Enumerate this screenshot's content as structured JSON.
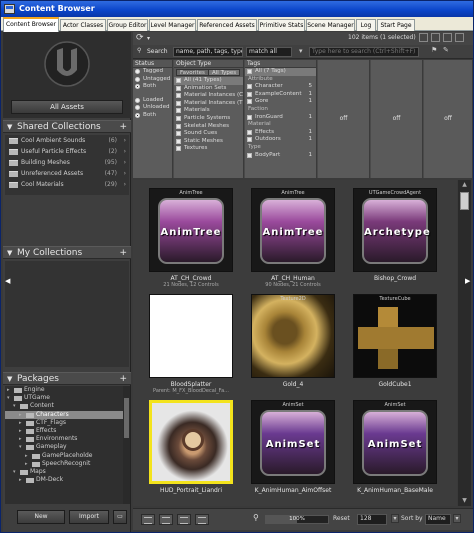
{
  "window": {
    "title": "Content Browser"
  },
  "tabs": [
    {
      "label": "Content Browser"
    },
    {
      "label": "Actor Classes"
    },
    {
      "label": "Group Editor"
    },
    {
      "label": "Level Manager"
    },
    {
      "label": "Referenced Assets"
    },
    {
      "label": "Primitive Stats"
    },
    {
      "label": "Scene Manager"
    },
    {
      "label": "Log"
    },
    {
      "label": "Start Page"
    }
  ],
  "left": {
    "all_assets_label": "All Assets",
    "shared_collections": {
      "title": "Shared Collections",
      "items": [
        {
          "label": "Cool Ambient Sounds",
          "count": "(6)"
        },
        {
          "label": "Useful Particle Effects",
          "count": "(2)"
        },
        {
          "label": "Building Meshes",
          "count": "(95)"
        },
        {
          "label": "Unreferenced Assets",
          "count": "(47)"
        },
        {
          "label": "Cool Materials",
          "count": "(29)"
        }
      ]
    },
    "my_collections": {
      "title": "My Collections"
    },
    "packages": {
      "title": "Packages",
      "tree": [
        {
          "label": "Engine"
        },
        {
          "label": "UTGame"
        },
        {
          "label": "Content"
        },
        {
          "label": "Characters"
        },
        {
          "label": "CTF_Flags"
        },
        {
          "label": "Effects"
        },
        {
          "label": "Environments"
        },
        {
          "label": "Gameplay"
        },
        {
          "label": "GamePlaceholde"
        },
        {
          "label": "SpeechRecognit"
        },
        {
          "label": "Maps"
        },
        {
          "label": "DM-Deck"
        }
      ]
    },
    "new_label": "New",
    "import_label": "Import"
  },
  "toolbar": {
    "items_count": "102 items (1 selected)",
    "search_label": "Search",
    "search_fields": "name, path, tags, type",
    "match_mode": "match all",
    "search_placeholder": "Type here to search (Ctrl+Shift+F)"
  },
  "filters": {
    "status": {
      "title": "Status",
      "rows": [
        {
          "label": "Tagged",
          "on": false
        },
        {
          "label": "Untagged",
          "on": false
        },
        {
          "label": "Both",
          "on": true
        },
        {
          "label": "Loaded",
          "on": false
        },
        {
          "label": "Unloaded",
          "on": false
        },
        {
          "label": "Both",
          "on": true
        }
      ]
    },
    "object_type": {
      "title": "Object Type",
      "tab_favorites": "Favorites",
      "tab_all_types": "All Types",
      "rows": [
        "All (41 Types)",
        "Animation Sets",
        "Material Instances (C",
        "Material Instances (T",
        "Materials",
        "Particle Systems",
        "Skeletal Meshes",
        "Sound Cues",
        "Static Meshes",
        "Textures"
      ]
    },
    "tags": {
      "title": "Tags",
      "rows": [
        {
          "label": "All (7 Tags)",
          "type": "item",
          "count": ""
        },
        {
          "label": "Attribute",
          "type": "header",
          "count": ""
        },
        {
          "label": "Character",
          "type": "item",
          "count": "5"
        },
        {
          "label": "ExampleContent",
          "type": "item",
          "count": "1"
        },
        {
          "label": "Gore",
          "type": "item",
          "count": "1"
        },
        {
          "label": "Faction",
          "type": "header",
          "count": ""
        },
        {
          "label": "IronGuard",
          "type": "item",
          "count": "1"
        },
        {
          "label": "Material",
          "type": "header",
          "count": ""
        },
        {
          "label": "Effects",
          "type": "item",
          "count": "1"
        },
        {
          "label": "Outdoors",
          "type": "item",
          "count": "1"
        },
        {
          "label": "Type",
          "type": "header",
          "count": ""
        },
        {
          "label": "BodyPart",
          "type": "item",
          "count": "1"
        }
      ]
    },
    "off1": "off",
    "off2": "off",
    "off3": "off"
  },
  "assets": [
    {
      "type": "AnimTree",
      "button_text": "AnimTree",
      "name": "AT_CH_Crowd",
      "info": "21 Nodes, 12 Controls",
      "kind": "animtree",
      "selected": false
    },
    {
      "type": "AnimTree",
      "button_text": "AnimTree",
      "name": "AT_CH_Human",
      "info": "90 Nodes, 21 Controls",
      "kind": "animtree",
      "selected": false
    },
    {
      "type": "UTGameCrowdAgent",
      "button_text": "Archetype",
      "name": "Bishop_Crowd",
      "info": "",
      "kind": "archetype",
      "selected": false
    },
    {
      "type": "",
      "button_text": "",
      "name": "BloodSplatter",
      "info": "Parent: M_FX_BloodDecal_Fa...",
      "kind": "white",
      "selected": false
    },
    {
      "type": "Texture2D",
      "button_text": "",
      "name": "Gold_4",
      "info": "",
      "kind": "texture",
      "selected": false
    },
    {
      "type": "TextureCube",
      "button_text": "",
      "name": "GoldCube1",
      "info": "",
      "kind": "cube",
      "selected": false
    },
    {
      "type": "",
      "button_text": "",
      "name": "HUD_Portrait_Liandri",
      "info": "",
      "kind": "portrait",
      "selected": true
    },
    {
      "type": "AnimSet",
      "button_text": "AnimSet",
      "name": "K_AnimHuman_AimOffset",
      "info": "",
      "kind": "animset",
      "selected": false
    },
    {
      "type": "AnimSet",
      "button_text": "AnimSet",
      "name": "K_AnimHuman_BaseMale",
      "info": "",
      "kind": "animset",
      "selected": false
    }
  ],
  "bottom": {
    "zoom": "100%",
    "reset_label": "Reset",
    "thumb_size": "128",
    "sort_label": "Sort by",
    "sort_value": "Name"
  },
  "colors": {
    "selection": "#f3e31c",
    "animtree": "#9a4a9c",
    "archetype": "#7a3a7a",
    "animset": "#6a3a90",
    "titlebar": "#0a44c8"
  }
}
